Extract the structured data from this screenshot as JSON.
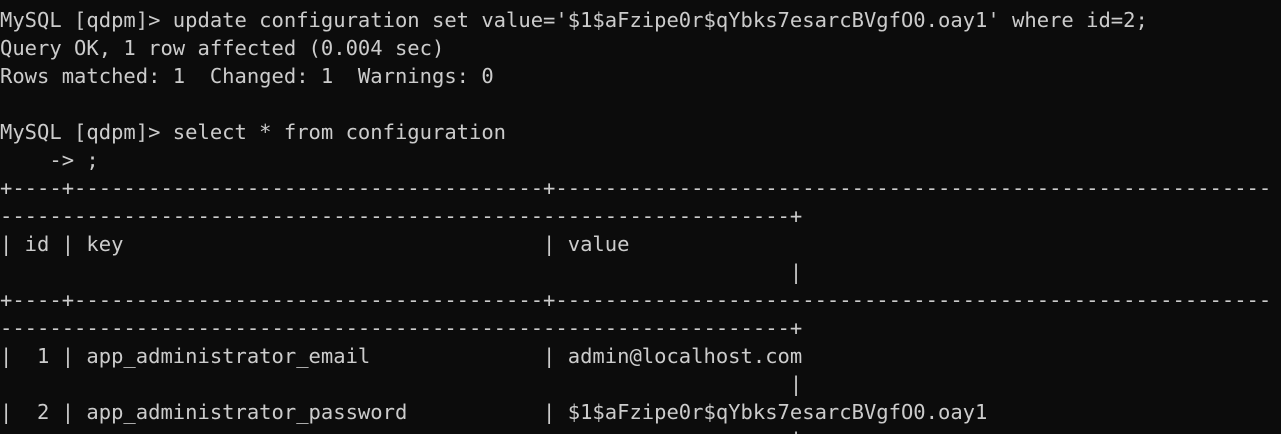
{
  "terminal": {
    "lines": [
      "MySQL [qdpm]> update configuration set value='$1$aFzipe0r$qYbks7esarcBVgfO0.oay1' where id=2;",
      "Query OK, 1 row affected (0.004 sec)",
      "Rows matched: 1  Changed: 1  Warnings: 0",
      "",
      "MySQL [qdpm]> select * from configuration",
      "    -> ;",
      "+----+--------------------------------------+----------------------------------------------------------",
      "----------------------------------------------------------------+",
      "| id | key                                  | value",
      "                                                                |",
      "+----+--------------------------------------+----------------------------------------------------------",
      "----------------------------------------------------------------+",
      "|  1 | app_administrator_email              | admin@localhost.com",
      "                                                                |",
      "|  2 | app_administrator_password           | $1$aFzipe0r$qYbks7esarcBVgfO0.oay1",
      "                                                                |"
    ]
  }
}
